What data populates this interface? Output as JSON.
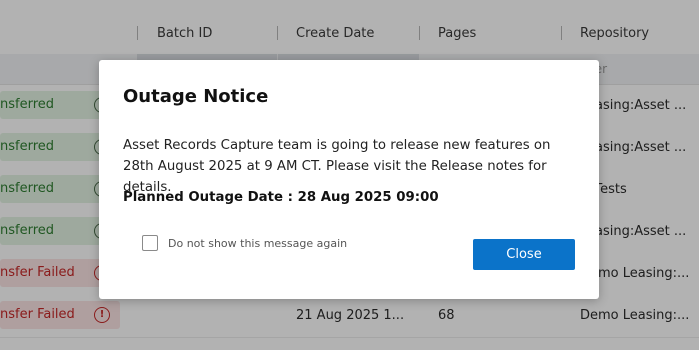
{
  "table": {
    "headers": [
      "Batch ID",
      "Create Date",
      "Pages",
      "Repository"
    ],
    "filter_repository": "ter",
    "rows": [
      {
        "status": "nsferred",
        "status_type": "ok",
        "create_date": "",
        "pages": "",
        "repository": "Leasing:Asset ..."
      },
      {
        "status": "nsferred",
        "status_type": "ok",
        "create_date": "",
        "pages": "",
        "repository": "Leasing:Asset ..."
      },
      {
        "status": "nsferred",
        "status_type": "ok",
        "create_date": "",
        "pages": "",
        "repository": "D:Tests"
      },
      {
        "status": "nsferred",
        "status_type": "ok",
        "create_date": "",
        "pages": "",
        "repository": "Leasing:Asset ..."
      },
      {
        "status": "nsfer Failed",
        "status_type": "fail",
        "create_date": "",
        "pages": "",
        "repository": "Demo Leasing:..."
      },
      {
        "status": "nsfer Failed",
        "status_type": "fail",
        "create_date": "21 Aug 2025 1...",
        "pages": "68",
        "repository": "Demo Leasing:..."
      }
    ]
  },
  "modal": {
    "title": "Outage Notice",
    "body": "Asset Records Capture team is going to release new features on 28th August 2025 at 9 AM CT. Please visit the Release notes for details.",
    "outage_label": "Planned Outage Date : 28 Aug 2025 09:00",
    "checkbox_label": "Do not show this message again",
    "checkbox_checked": false,
    "close_label": "Close"
  },
  "icons": {
    "ok_status": "info-icon",
    "fail_status": "error-icon"
  }
}
